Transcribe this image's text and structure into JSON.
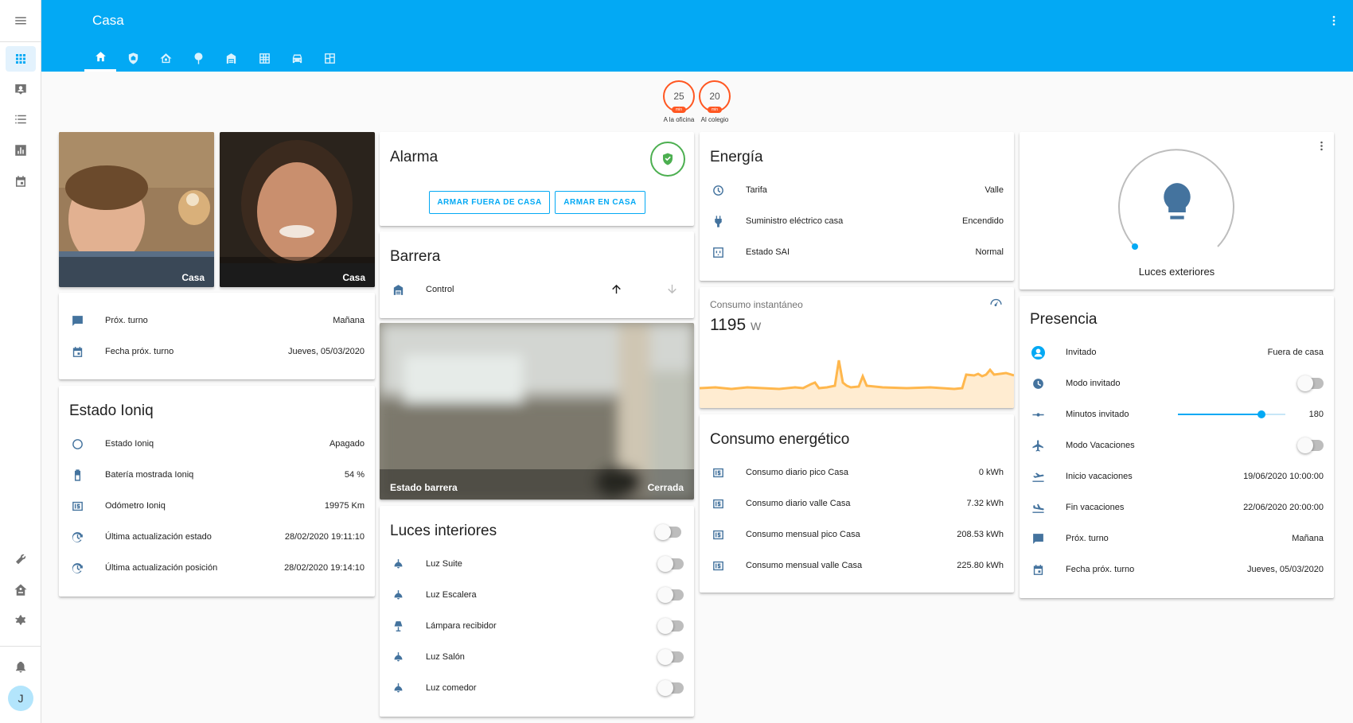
{
  "app": {
    "title": "Casa"
  },
  "sidebar": {
    "avatar_initial": "J"
  },
  "travel": [
    {
      "value": "25",
      "unit": "min",
      "label": "A la oficina"
    },
    {
      "value": "20",
      "unit": "min",
      "label": "Al colegio"
    }
  ],
  "persons": [
    {
      "name": "Casa"
    },
    {
      "name": "Casa"
    }
  ],
  "turno": {
    "rows": [
      {
        "name": "Próx. turno",
        "value": "Mañana"
      },
      {
        "name": "Fecha próx. turno",
        "value": "Jueves, 05/03/2020"
      }
    ]
  },
  "ioniq": {
    "title": "Estado Ioniq",
    "rows": [
      {
        "name": "Estado Ioniq",
        "value": "Apagado"
      },
      {
        "name": "Batería mostrada Ioniq",
        "value": "54 %"
      },
      {
        "name": "Odómetro Ioniq",
        "value": "19975 Km"
      },
      {
        "name": "Última actualización estado",
        "value": "28/02/2020 19:11:10"
      },
      {
        "name": "Última actualización posición",
        "value": "28/02/2020 19:14:10"
      }
    ]
  },
  "alarm": {
    "title": "Alarma",
    "btn_away": "ARMAR FUERA DE CASA",
    "btn_home": "ARMAR EN CASA"
  },
  "barrera": {
    "title": "Barrera",
    "control_label": "Control"
  },
  "camera": {
    "name": "Estado barrera",
    "state": "Cerrada"
  },
  "luces": {
    "title": "Luces interiores",
    "rows": [
      {
        "name": "Luz Suite"
      },
      {
        "name": "Luz Escalera"
      },
      {
        "name": "Lámpara recibidor"
      },
      {
        "name": "Luz Salón"
      },
      {
        "name": "Luz comedor"
      }
    ]
  },
  "energia": {
    "title": "Energía",
    "rows": [
      {
        "name": "Tarifa",
        "value": "Valle"
      },
      {
        "name": "Suministro eléctrico casa",
        "value": "Encendido"
      },
      {
        "name": "Estado SAI",
        "value": "Normal"
      }
    ]
  },
  "consumo_inst": {
    "title": "Consumo instantáneo",
    "value": "1195",
    "unit": "W"
  },
  "consumo_energ": {
    "title": "Consumo energético",
    "rows": [
      {
        "name": "Consumo diario pico Casa",
        "value": "0 kWh"
      },
      {
        "name": "Consumo diario valle Casa",
        "value": "7.32 kWh"
      },
      {
        "name": "Consumo mensual pico Casa",
        "value": "208.53 kWh"
      },
      {
        "name": "Consumo mensual valle Casa",
        "value": "225.80 kWh"
      }
    ]
  },
  "luces_ext": {
    "name": "Luces exteriores"
  },
  "presencia": {
    "title": "Presencia",
    "rows": [
      {
        "name": "Invitado",
        "value": "Fuera de casa"
      },
      {
        "name": "Modo invitado",
        "value": ""
      },
      {
        "name": "Minutos invitado",
        "value": "180",
        "slider_fraction": 0.78
      },
      {
        "name": "Modo Vacaciones",
        "value": ""
      },
      {
        "name": "Inicio vacaciones",
        "value": "19/06/2020 10:00:00"
      },
      {
        "name": "Fin vacaciones",
        "value": "22/06/2020 20:00:00"
      },
      {
        "name": "Próx. turno",
        "value": "Mañana"
      },
      {
        "name": "Fecha próx. turno",
        "value": "Jueves, 05/03/2020"
      }
    ]
  },
  "colors": {
    "primary": "#03a9f4",
    "icon": "#44739e",
    "accent": "#ff5722",
    "graph": "#ffb74d",
    "alarm_ok": "#4caf50"
  }
}
